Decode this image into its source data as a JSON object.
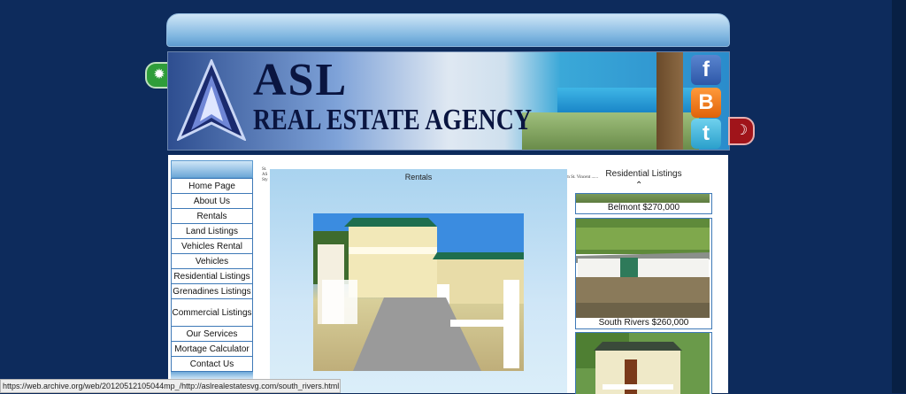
{
  "brand": {
    "name_line1": "ASL",
    "name_line2": "REAL ESTATE AGENCY"
  },
  "social": {
    "facebook": "f",
    "blogger": "B",
    "twitter": "t"
  },
  "sidebar": {
    "items": [
      {
        "label": "Home Page"
      },
      {
        "label": "About Us"
      },
      {
        "label": "Rentals"
      },
      {
        "label": "Land Listings"
      },
      {
        "label": "Vehicles Rental"
      },
      {
        "label": "Vehicles"
      },
      {
        "label": "Residential Listings"
      },
      {
        "label": "Grenadines Listings"
      },
      {
        "label": "Commercial Listings"
      },
      {
        "label": "Our Services"
      },
      {
        "label": "Mortage Calculator"
      },
      {
        "label": "Contact Us"
      }
    ]
  },
  "main": {
    "tiny_left": "St. AS Sty",
    "tiny_right": "m St. Vincent ......",
    "rentals_title": "Rentals"
  },
  "residential": {
    "title": "Residential Listings",
    "arrow": "⌃",
    "listings": [
      {
        "caption": "Belmont $270,000"
      },
      {
        "caption": "South Rivers $260,000"
      }
    ]
  },
  "statusbar": {
    "url": "https://web.archive.org/web/20120512105044mp_/http://aslrealestatesvg.com/south_rivers.html"
  },
  "colors": {
    "page_bg": "#0d2b5c",
    "nav_border": "#3e79b7",
    "tab_light": "#cfe6f7"
  }
}
